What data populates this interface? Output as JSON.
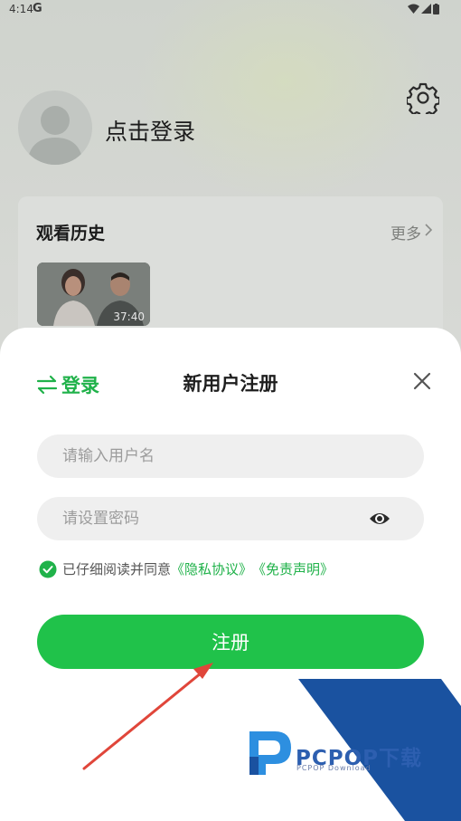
{
  "status_bar": {
    "time": "4:14",
    "carrier_icon": "G"
  },
  "profile": {
    "login_prompt": "点击登录"
  },
  "history": {
    "title": "观看历史",
    "more_label": "更多",
    "thumb_duration": "37:40"
  },
  "register_sheet": {
    "switch_label": "登录",
    "title": "新用户注册",
    "username_placeholder": "请输入用户名",
    "password_placeholder": "请设置密码",
    "agree_text": "已仔细阅读并同意",
    "privacy_link": "《隐私协议》",
    "disclaimer_link": "《免责声明》",
    "register_button": "注册"
  },
  "watermark": {
    "brand": "PCPOP下载",
    "sub": "PCPOP Download"
  },
  "colors": {
    "accent": "#20c24a",
    "link": "#20b24a",
    "arrow": "#e0463a",
    "watermark_blue": "#1a52a0"
  }
}
